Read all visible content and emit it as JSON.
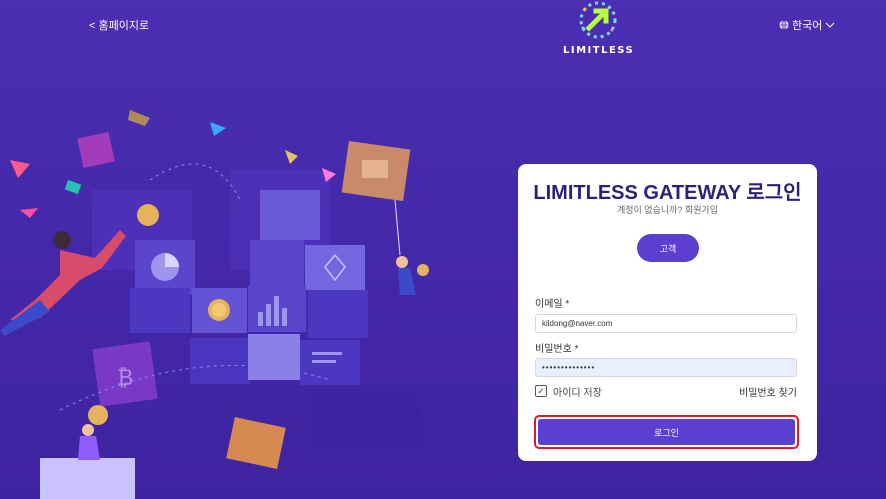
{
  "header": {
    "back_link": "< 홈페이지로",
    "logo_text": "LIMITLESS",
    "language": "한국어",
    "globe_icon": "globe-icon",
    "chevron_icon": "chevron-down-icon"
  },
  "login_card": {
    "title": "LIMITLESS GATEWAY 로그인",
    "no_account_text": "계정이 없습니까?",
    "signup_link": "회원가입",
    "user_type_button": "고객",
    "email_label": "이메일 *",
    "email_value": "kildong@naver.com",
    "password_label": "비밀번호 *",
    "password_value": "••••••••••••••",
    "remember_id_label": "아이디 저장",
    "remember_id_checked": true,
    "find_password_link": "비밀번호 찾기",
    "login_button": "로그인"
  },
  "colors": {
    "background": "#4a2fb2",
    "accent": "#5b3fd0",
    "highlight_border": "#e0192c",
    "title": "#2e1f7a"
  }
}
